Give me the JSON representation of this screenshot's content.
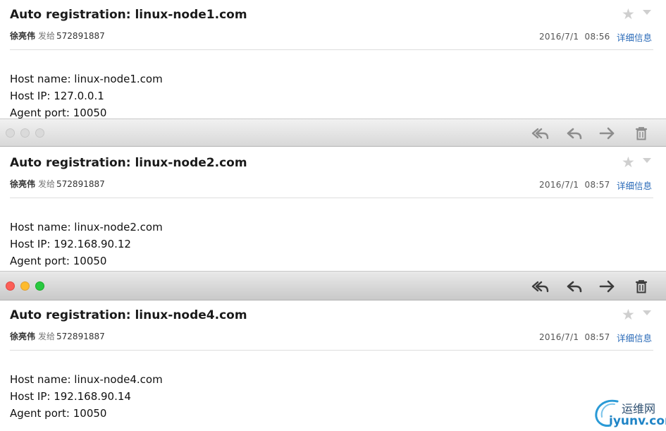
{
  "emails": [
    {
      "subject": "Auto registration: linux-node1.com",
      "sender": "徐亮伟",
      "sent_to_label": "发给",
      "recipient": "572891887",
      "date": "2016/7/1",
      "time": "08:56",
      "details_link": "详细信息",
      "body": [
        "Host name: linux-node1.com",
        "Host IP: 127.0.0.1",
        "Agent port: 10050"
      ]
    },
    {
      "subject": "Auto registration: linux-node2.com",
      "sender": "徐亮伟",
      "sent_to_label": "发给",
      "recipient": "572891887",
      "date": "2016/7/1",
      "time": "08:57",
      "details_link": "详细信息",
      "body": [
        "Host name: linux-node2.com",
        "Host IP: 192.168.90.12",
        "Agent port: 10050"
      ]
    },
    {
      "subject": "Auto registration: linux-node4.com",
      "sender": "徐亮伟",
      "sent_to_label": "发给",
      "recipient": "572891887",
      "date": "2016/7/1",
      "time": "08:57",
      "details_link": "详细信息",
      "body": [
        "Host name: linux-node4.com",
        "Host IP: 192.168.90.14",
        "Agent port: 10050"
      ]
    }
  ],
  "icons": {
    "star": "★",
    "toolbar": [
      "reply-all-icon",
      "reply-icon",
      "forward-icon",
      "trash-icon"
    ]
  },
  "colors": {
    "link": "#2a6ab8",
    "close": "#fc5f57",
    "minimize": "#fdbb2e",
    "maximize": "#29c940"
  },
  "watermark": {
    "name_cn": "运维网",
    "domain": "iyunv.com"
  }
}
